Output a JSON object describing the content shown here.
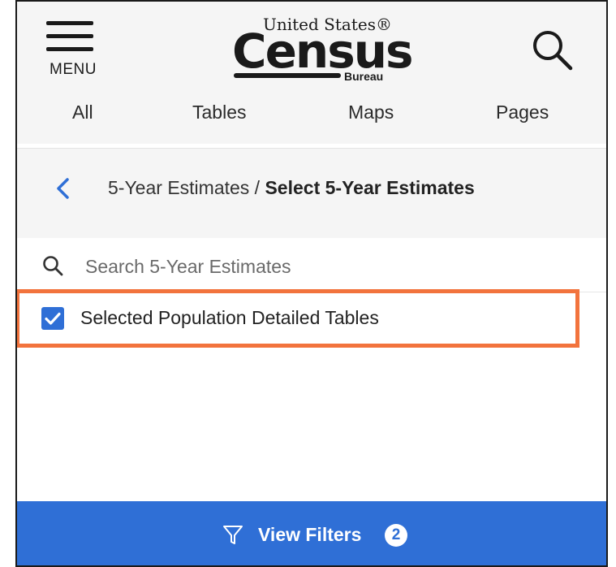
{
  "header": {
    "menu_label": "MENU",
    "logo": {
      "line1": "United States®",
      "main": "Census",
      "line3": "Bureau"
    },
    "tabs": [
      {
        "label": "All"
      },
      {
        "label": "Tables"
      },
      {
        "label": "Maps"
      },
      {
        "label": "Pages"
      }
    ]
  },
  "breadcrumb": {
    "parent": "5-Year Estimates",
    "separator": " / ",
    "current": "Select 5-Year Estimates"
  },
  "search": {
    "placeholder": "Search 5-Year Estimates",
    "value": ""
  },
  "options": [
    {
      "label": "Selected Population Detailed Tables",
      "checked": true
    }
  ],
  "footer": {
    "label": "View Filters",
    "badge_count": "2"
  },
  "colors": {
    "accent": "#2f6fd6",
    "highlight": "#f2733d",
    "header_bg": "#f5f5f5"
  }
}
